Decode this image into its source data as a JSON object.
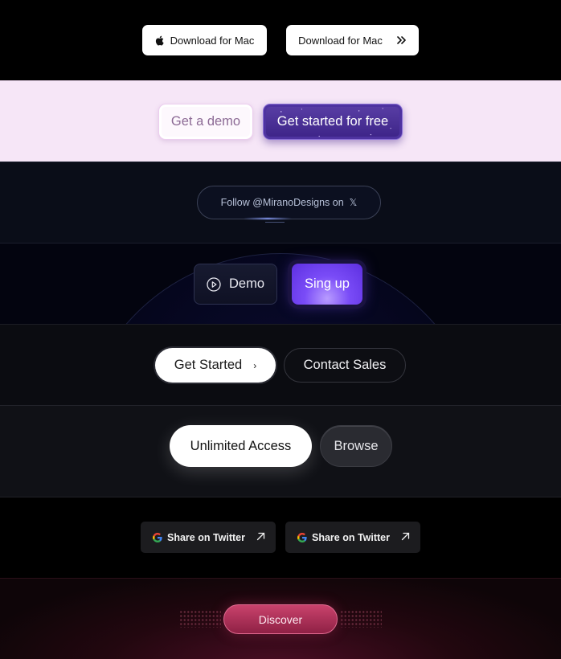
{
  "row1": {
    "mac_download": "Download for Mac",
    "mac_download_alt": "Download for Mac"
  },
  "row2": {
    "demo": "Get a demo",
    "free": "Get started for free"
  },
  "row3": {
    "follow": "Follow @MiranoDesigns on",
    "x_glyph": "𝕏"
  },
  "row4": {
    "demo": "Demo",
    "signup": "Sing up"
  },
  "row5": {
    "started": "Get Started",
    "chevron": "›",
    "sales": "Contact Sales"
  },
  "row6": {
    "unlimited": "Unlimited Access",
    "browse": "Browse"
  },
  "row7": {
    "share1": "Share on Twitter",
    "share2": "Share on Twitter"
  },
  "row8": {
    "discover": "Discover"
  },
  "colors": {
    "accent_purple": "#7a4cf7",
    "accent_pink": "#c9426c",
    "pastel_bg": "#f6e6f7"
  }
}
